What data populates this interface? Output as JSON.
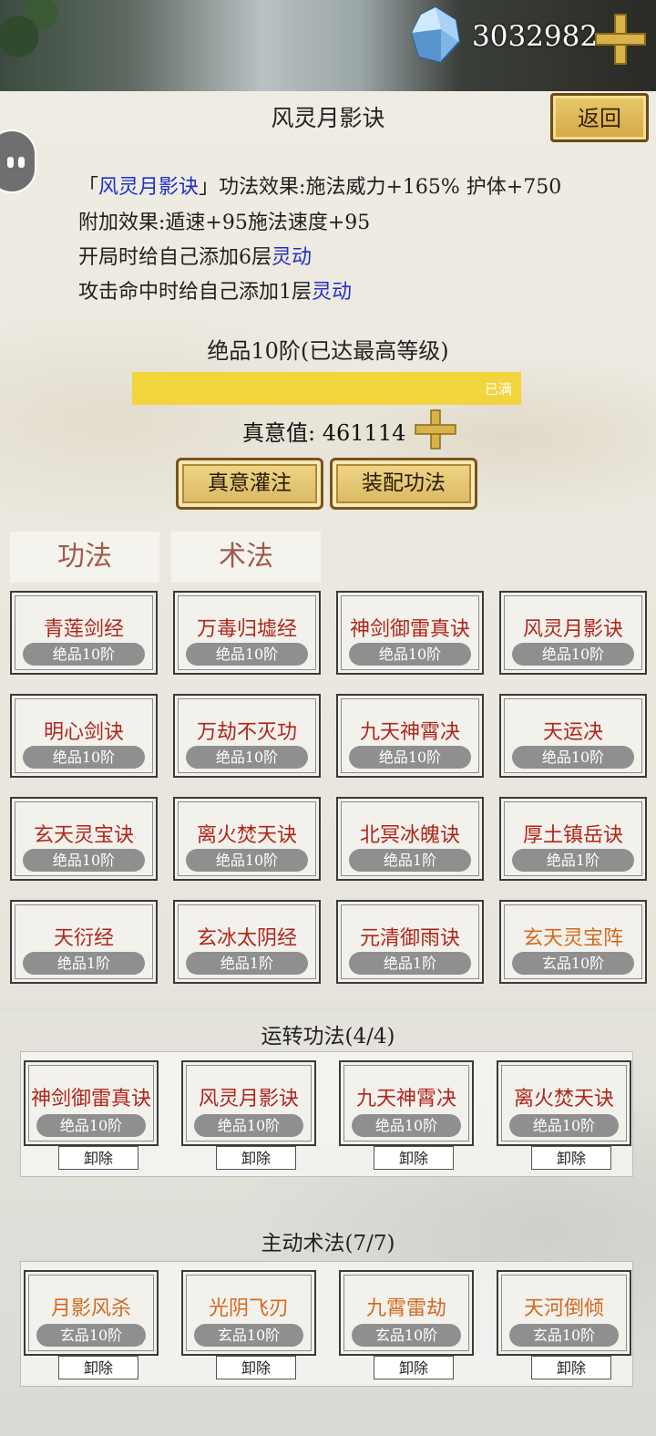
{
  "header": {
    "currency": "3032982"
  },
  "page_title": "风灵月影诀",
  "back_label": "返回",
  "description": {
    "line1": {
      "open": "「",
      "name": "风灵月影诀",
      "close": "」",
      "rest": "功法效果:施法威力+165% 护体+750"
    },
    "line2": "附加效果:遁速+95施法速度+95",
    "line3": {
      "text": "开局时给自己添加6层",
      "keyword": "灵动"
    },
    "line4": {
      "text": "攻击命中时给自己添加1层",
      "keyword": "灵动"
    }
  },
  "grade_title": "绝品10阶(已达最高等级)",
  "progress": {
    "value": 1.0,
    "label": "已满"
  },
  "zhenyi": {
    "label": "真意值:",
    "value": "461114"
  },
  "buttons": {
    "infuse": "真意灌注",
    "equip": "装配功法"
  },
  "tabs": [
    "功法",
    "术法"
  ],
  "techniques": [
    {
      "name": "青莲剑经",
      "grade": "绝品10阶"
    },
    {
      "name": "万毒归墟经",
      "grade": "绝品10阶"
    },
    {
      "name": "神剑御雷真诀",
      "grade": "绝品10阶"
    },
    {
      "name": "风灵月影诀",
      "grade": "绝品10阶"
    },
    {
      "name": "明心剑诀",
      "grade": "绝品10阶"
    },
    {
      "name": "万劫不灭功",
      "grade": "绝品10阶"
    },
    {
      "name": "九天神霄决",
      "grade": "绝品10阶"
    },
    {
      "name": "天运决",
      "grade": "绝品10阶"
    },
    {
      "name": "玄天灵宝诀",
      "grade": "绝品10阶"
    },
    {
      "name": "离火焚天诀",
      "grade": "绝品10阶"
    },
    {
      "name": "北冥冰魄诀",
      "grade": "绝品1阶"
    },
    {
      "name": "厚土镇岳诀",
      "grade": "绝品1阶"
    },
    {
      "name": "天衍经",
      "grade": "绝品1阶"
    },
    {
      "name": "玄冰太阴经",
      "grade": "绝品1阶"
    },
    {
      "name": "元清御雨诀",
      "grade": "绝品1阶"
    },
    {
      "name": "玄天灵宝阵",
      "grade": "玄品10阶"
    }
  ],
  "running": {
    "title": "运转功法(4/4)",
    "items": [
      {
        "name": "神剑御雷真诀",
        "grade": "绝品10阶"
      },
      {
        "name": "风灵月影诀",
        "grade": "绝品10阶"
      },
      {
        "name": "九天神霄决",
        "grade": "绝品10阶"
      },
      {
        "name": "离火焚天诀",
        "grade": "绝品10阶"
      }
    ]
  },
  "active_skills": {
    "title": "主动术法(7/7)",
    "items": [
      {
        "name": "月影风杀",
        "grade": "玄品10阶"
      },
      {
        "name": "光阴飞刃",
        "grade": "玄品10阶"
      },
      {
        "name": "九霄雷劫",
        "grade": "玄品10阶"
      },
      {
        "name": "天河倒倾",
        "grade": "玄品10阶"
      }
    ]
  },
  "unload_label": "卸除",
  "colors": {
    "technique_red": "#b0261a",
    "skill_orange": "#d26a1f",
    "link_blue": "#1f2fc9",
    "bar_yellow": "#f2d43d"
  },
  "icons": [
    "crystal-gem-icon",
    "gold-plus-icon",
    "chat-bubble-icon"
  ]
}
